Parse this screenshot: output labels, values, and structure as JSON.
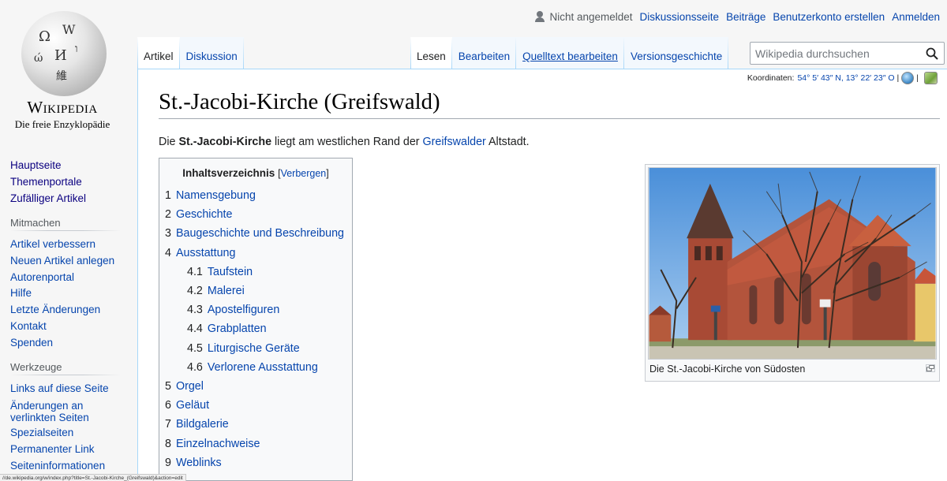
{
  "logo": {
    "wordmark": "Wikipedia",
    "tagline": "Die freie Enzyklopädie"
  },
  "personal_tools": {
    "user_status": "Nicht angemeldet",
    "links": [
      "Diskussionsseite",
      "Beiträge",
      "Benutzerkonto erstellen",
      "Anmelden"
    ]
  },
  "tabs": {
    "left": [
      {
        "label": "Artikel",
        "selected": true
      },
      {
        "label": "Diskussion",
        "selected": false
      }
    ],
    "right": [
      {
        "label": "Lesen",
        "selected": true
      },
      {
        "label": "Bearbeiten",
        "selected": false
      },
      {
        "label": "Quelltext bearbeiten",
        "selected": false
      },
      {
        "label": "Versionsgeschichte",
        "selected": false
      }
    ]
  },
  "search": {
    "placeholder": "Wikipedia durchsuchen"
  },
  "sidebar": {
    "navigation": [
      "Hauptseite",
      "Themenportale",
      "Zufälliger Artikel"
    ],
    "mitmachen_heading": "Mitmachen",
    "mitmachen": [
      "Artikel verbessern",
      "Neuen Artikel anlegen",
      "Autorenportal",
      "Hilfe",
      "Letzte Änderungen",
      "Kontakt",
      "Spenden"
    ],
    "werkzeuge_heading": "Werkzeuge",
    "werkzeuge": [
      "Links auf diese Seite",
      "Änderungen an verlinkten Seiten",
      "Spezialseiten",
      "Permanenter Link",
      "Seiteninformationen"
    ]
  },
  "coordinates": {
    "label": "Koordinaten:",
    "value": "54° 5′ 43″ N, 13° 22′ 23″ O"
  },
  "article": {
    "title": "St.-Jacobi-Kirche (Greifswald)",
    "lead_prefix": "Die ",
    "lead_bold": "St.-Jacobi-Kirche",
    "lead_middle": " liegt am westlichen Rand der ",
    "lead_link": "Greifswalder",
    "lead_suffix": " Altstadt."
  },
  "toc": {
    "title": "Inhaltsverzeichnis",
    "toggle": "Verbergen",
    "entries": [
      {
        "num": "1",
        "label": "Namensgebung",
        "level": 1
      },
      {
        "num": "2",
        "label": "Geschichte",
        "level": 1
      },
      {
        "num": "3",
        "label": "Baugeschichte und Beschreibung",
        "level": 1
      },
      {
        "num": "4",
        "label": "Ausstattung",
        "level": 1
      },
      {
        "num": "4.1",
        "label": "Taufstein",
        "level": 2
      },
      {
        "num": "4.2",
        "label": "Malerei",
        "level": 2
      },
      {
        "num": "4.3",
        "label": "Apostelfiguren",
        "level": 2
      },
      {
        "num": "4.4",
        "label": "Grabplatten",
        "level": 2
      },
      {
        "num": "4.5",
        "label": "Liturgische Geräte",
        "level": 2
      },
      {
        "num": "4.6",
        "label": "Verlorene Ausstattung",
        "level": 2
      },
      {
        "num": "5",
        "label": "Orgel",
        "level": 1
      },
      {
        "num": "6",
        "label": "Geläut",
        "level": 1
      },
      {
        "num": "7",
        "label": "Bildgalerie",
        "level": 1
      },
      {
        "num": "8",
        "label": "Einzelnachweise",
        "level": 1
      },
      {
        "num": "9",
        "label": "Weblinks",
        "level": 1
      }
    ]
  },
  "image": {
    "caption": "Die St.-Jacobi-Kirche von Südosten"
  },
  "statusbar": {
    "url": "//de.wikipedia.org/w/index.php?title=St.-Jacobi-Kirche_(Greifswald)&action=edit"
  },
  "colors": {
    "link": "#0645ad",
    "tab_border": "#a7d7f9"
  }
}
